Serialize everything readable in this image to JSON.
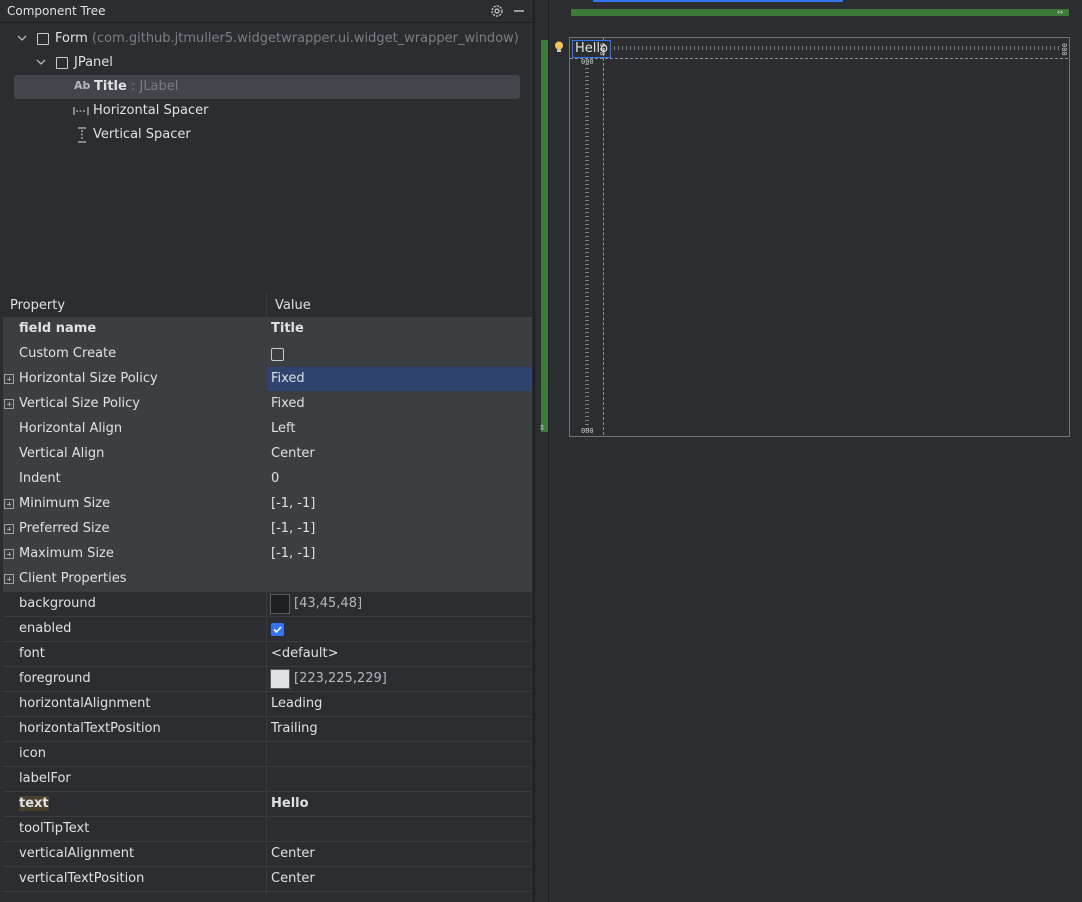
{
  "component_tree": {
    "title": "Component Tree",
    "settings_icon": "gear-icon",
    "minimize_icon": "minimize-icon",
    "nodes": [
      {
        "label": "Form",
        "detail": "(com.github.jtmuller5.widgetwrapper.ui.widget_wrapper_window)",
        "icon": "form-checkbox-icon"
      },
      {
        "label": "JPanel",
        "detail": "",
        "icon": "panel-checkbox-icon"
      },
      {
        "label": "Title",
        "sep": ":",
        "detail": "JLabel",
        "icon_text": "Ab"
      },
      {
        "label": "Horizontal Spacer",
        "detail": "",
        "icon": "horizontal-spacer-icon"
      },
      {
        "label": "Vertical Spacer",
        "detail": "",
        "icon": "vertical-spacer-icon"
      }
    ]
  },
  "properties": {
    "header": {
      "property": "Property",
      "value": "Value"
    },
    "rows": [
      {
        "name": "field name",
        "value": "Title"
      },
      {
        "name": "Custom Create",
        "value": ""
      },
      {
        "name": "Horizontal Size Policy",
        "value": "Fixed"
      },
      {
        "name": "Vertical Size Policy",
        "value": "Fixed"
      },
      {
        "name": "Horizontal Align",
        "value": "Left"
      },
      {
        "name": "Vertical Align",
        "value": "Center"
      },
      {
        "name": "Indent",
        "value": "0"
      },
      {
        "name": "Minimum Size",
        "value": "[-1, -1]"
      },
      {
        "name": "Preferred Size",
        "value": "[-1, -1]"
      },
      {
        "name": "Maximum Size",
        "value": "[-1, -1]"
      },
      {
        "name": "Client Properties",
        "value": ""
      },
      {
        "name": "background",
        "value": "[43,45,48]",
        "color": "#2b2d30"
      },
      {
        "name": "enabled",
        "value": ""
      },
      {
        "name": "font",
        "value": "<default>"
      },
      {
        "name": "foreground",
        "value": "[223,225,229]",
        "color": "#dfe1e5"
      },
      {
        "name": "horizontalAlignment",
        "value": "Leading"
      },
      {
        "name": "horizontalTextPosition",
        "value": "Trailing"
      },
      {
        "name": "icon",
        "value": ""
      },
      {
        "name": "labelFor",
        "value": ""
      },
      {
        "name": "text",
        "value": "Hello"
      },
      {
        "name": "toolTipText",
        "value": ""
      },
      {
        "name": "verticalAlignment",
        "value": "Center"
      },
      {
        "name": "verticalTextPosition",
        "value": "Center"
      }
    ]
  },
  "designer": {
    "label_text": "Hello",
    "hint_icon": "lightbulb-icon",
    "grid_marker": "000",
    "resize_h": "⇔",
    "resize_v": "⇕"
  },
  "colors": {
    "accent": "#3574f0",
    "layout_green": "#3d7a3a",
    "selection": "#2e436e"
  }
}
